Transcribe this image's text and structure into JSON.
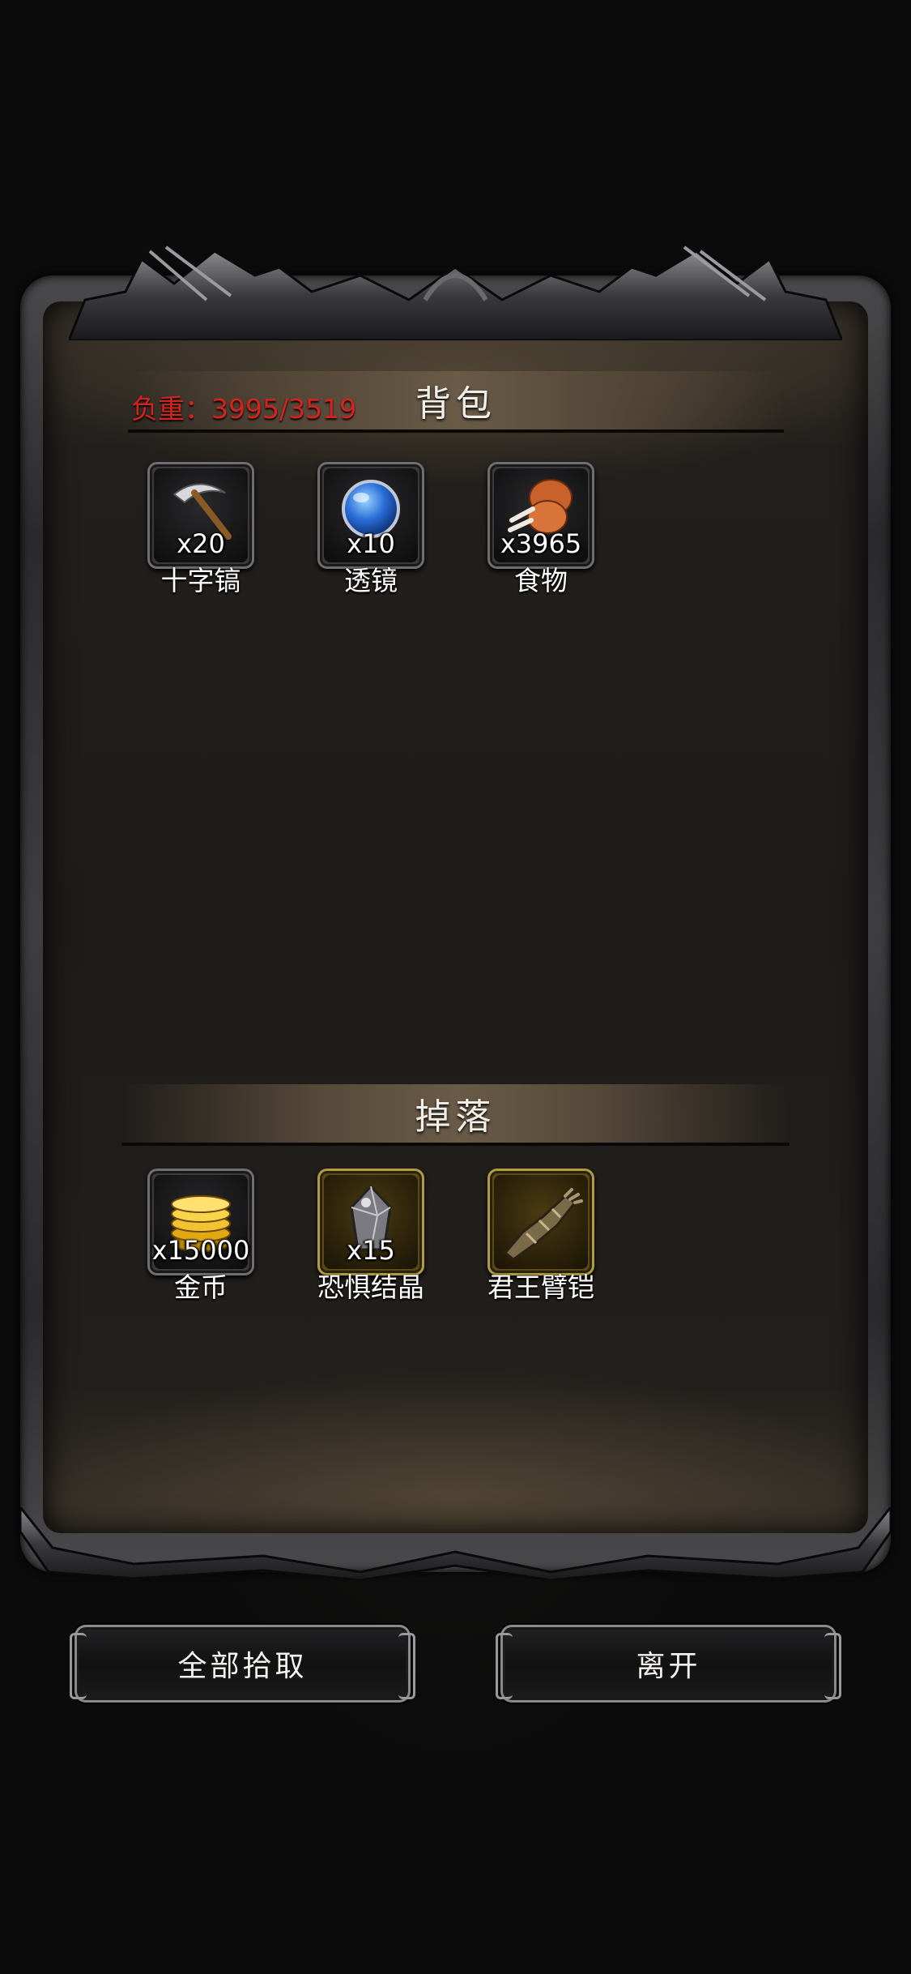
{
  "inventory": {
    "title": "背包",
    "weight_label": "负重：3995/3519",
    "items": [
      {
        "name": "十字镐",
        "qty": "x20",
        "icon": "pickaxe-icon"
      },
      {
        "name": "透镜",
        "qty": "x10",
        "icon": "lens-icon"
      },
      {
        "name": "食物",
        "qty": "x3965",
        "icon": "drumstick-icon"
      }
    ]
  },
  "loot": {
    "title": "掉落",
    "items": [
      {
        "name": "金币",
        "qty": "x15000",
        "icon": "gold-coins-icon"
      },
      {
        "name": "恐惧结晶",
        "qty": "x15",
        "icon": "fear-crystal-icon"
      },
      {
        "name": "君王臂铠",
        "qty": "",
        "icon": "gauntlet-icon"
      }
    ]
  },
  "actions": {
    "pick_all": "全部拾取",
    "leave": "离开"
  },
  "colors": {
    "weight_text": "#d8221e",
    "rare_slot_border": "#b29a42"
  }
}
